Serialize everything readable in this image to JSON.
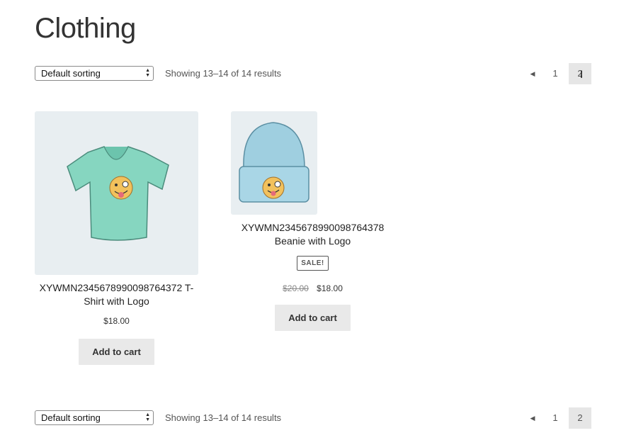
{
  "page": {
    "title": "Clothing"
  },
  "toolbar_top": {
    "sort_label": "Default sorting",
    "result_count": "Showing 13–14 of 14 results",
    "prev_icon": "◀",
    "page_1": "1",
    "page_2": "2"
  },
  "toolbar_bottom": {
    "sort_label": "Default sorting",
    "result_count": "Showing 13–14 of 14 results",
    "prev_icon": "◀",
    "page_1": "1",
    "page_2": "2"
  },
  "products": [
    {
      "name": "XYWMN2345678990098764372 T-Shirt with Logo",
      "price": "$18.00",
      "add_to_cart": "Add to cart"
    },
    {
      "name": "XYWMN2345678990098764378 Beanie with Logo",
      "badge": "SALE!",
      "old_price": "$20.00",
      "price": "$18.00",
      "add_to_cart": "Add to cart"
    }
  ],
  "colors": {
    "button_bg": "#e9e9e9",
    "thumb_bg": "#e8eef1",
    "shirt": "#86d6c0",
    "beanie": "#9fcfe0"
  }
}
